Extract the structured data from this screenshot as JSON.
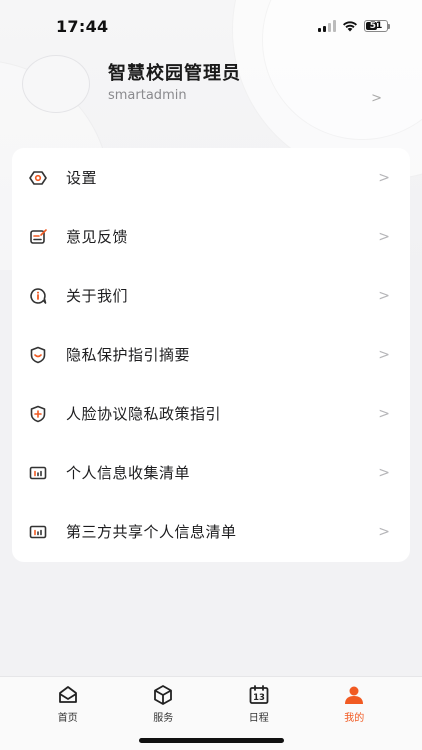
{
  "status_bar": {
    "time": "17:44",
    "battery": "51",
    "battery_level": 0.51
  },
  "profile": {
    "name": "智慧校园管理员",
    "account": "smartadmin",
    "chevron": ">"
  },
  "menu": {
    "chevron": ">",
    "items": [
      {
        "label": "设置",
        "icon": "gear-hex-icon"
      },
      {
        "label": "意见反馈",
        "icon": "feedback-icon"
      },
      {
        "label": "关于我们",
        "icon": "info-bubble-icon"
      },
      {
        "label": "隐私保护指引摘要",
        "icon": "shield-smile-icon"
      },
      {
        "label": "人脸协议隐私政策指引",
        "icon": "shield-plus-icon"
      },
      {
        "label": "个人信息收集清单",
        "icon": "list-chart-icon"
      },
      {
        "label": "第三方共享个人信息清单",
        "icon": "list-chart-icon"
      }
    ]
  },
  "tabs": [
    {
      "label": "首页",
      "icon": "home-tray-icon",
      "active": false
    },
    {
      "label": "服务",
      "icon": "cube-icon",
      "active": false
    },
    {
      "label": "日程",
      "icon": "calendar-icon",
      "calendar_day": "13",
      "active": false
    },
    {
      "label": "我的",
      "icon": "person-icon",
      "active": true
    }
  ],
  "colors": {
    "accent": "#f15a22",
    "icon_dark": "#333333"
  }
}
